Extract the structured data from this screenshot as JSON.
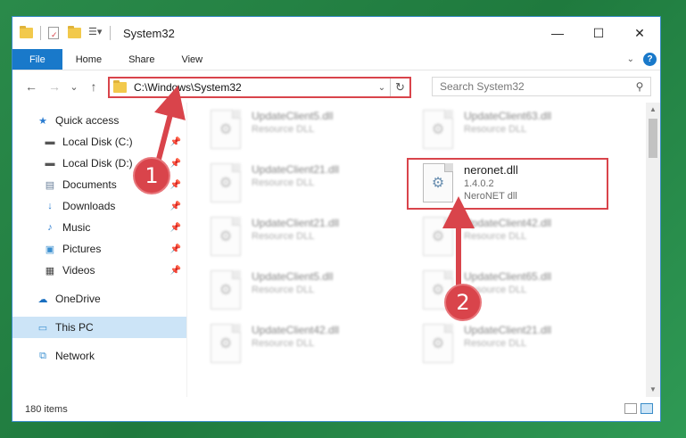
{
  "window": {
    "title": "System32",
    "controls": {
      "minimize": "—",
      "maximize": "☐",
      "close": "✕"
    }
  },
  "ribbon": {
    "tabs": [
      "File",
      "Home",
      "Share",
      "View"
    ],
    "help": "?"
  },
  "navigation": {
    "back": "←",
    "forward": "→",
    "recent": "⌄",
    "up": "↑",
    "address": "C:\\Windows\\System32",
    "search_placeholder": "Search System32"
  },
  "sidebar": {
    "quick_access": "Quick access",
    "pinned": [
      {
        "label": "Local Disk (C:)",
        "icon": "drive-icon"
      },
      {
        "label": "Local Disk (D:)",
        "icon": "drive-icon"
      },
      {
        "label": "Documents",
        "icon": "documents-icon"
      },
      {
        "label": "Downloads",
        "icon": "downloads-icon"
      },
      {
        "label": "Music",
        "icon": "music-icon"
      },
      {
        "label": "Pictures",
        "icon": "pictures-icon"
      },
      {
        "label": "Videos",
        "icon": "videos-icon"
      }
    ],
    "onedrive": "OneDrive",
    "this_pc": "This PC",
    "network": "Network"
  },
  "files": {
    "left_column": [
      {
        "name": "UpdateClient5.dll",
        "type": "Resource DLL"
      },
      {
        "name": "UpdateClient21.dll",
        "type": "Resource DLL"
      },
      {
        "name": "UpdateClient21.dll",
        "type": "Resource DLL"
      },
      {
        "name": "UpdateClient5.dll",
        "type": "Resource DLL"
      },
      {
        "name": "UpdateClient42.dll",
        "type": "Resource DLL"
      }
    ],
    "right_column": [
      {
        "name": "UpdateClient63.dll",
        "type": "Resource DLL"
      },
      {
        "name": "UpdateClient42.dll",
        "type": "Resource DLL"
      },
      {
        "name": "UpdateClient65.dll",
        "type": "Resource DLL"
      },
      {
        "name": "UpdateClient21.dll",
        "type": "Resource DLL"
      }
    ],
    "highlighted": {
      "name": "neronet.dll",
      "version": "1.4.0.2",
      "description": "NeroNET dll"
    }
  },
  "status": {
    "item_count": "180 items"
  },
  "annotations": {
    "step1": "1",
    "step2": "2",
    "color": "#d9444b"
  }
}
